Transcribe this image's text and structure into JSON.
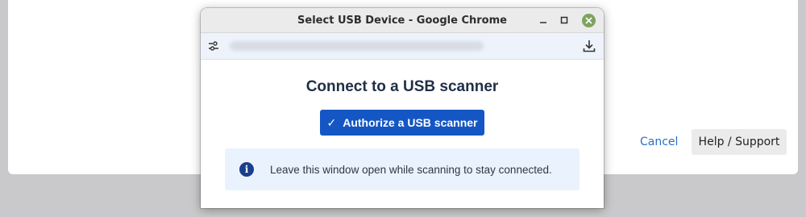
{
  "background": {
    "cancel_label": "Cancel",
    "help_label": "Help / Support"
  },
  "window": {
    "title": "Select USB Device - Google Chrome",
    "controls": [
      "minimize-icon",
      "maximize-icon",
      "close-icon"
    ]
  },
  "addressbar": {
    "left_icon": "site-settings-icon",
    "right_icon": "download-icon"
  },
  "dialog": {
    "heading": "Connect to a USB scanner",
    "button_check": "✓",
    "button_label": "Authorize a USB scanner",
    "info_icon": "i",
    "info_text": "Leave this window open while scanning to stay connected."
  },
  "colors": {
    "primary_button": "#1456c4",
    "info_bg": "#eaf3fd",
    "info_icon": "#1a3e8c",
    "link": "#2a6fc4",
    "close_button": "#7fa35e"
  }
}
